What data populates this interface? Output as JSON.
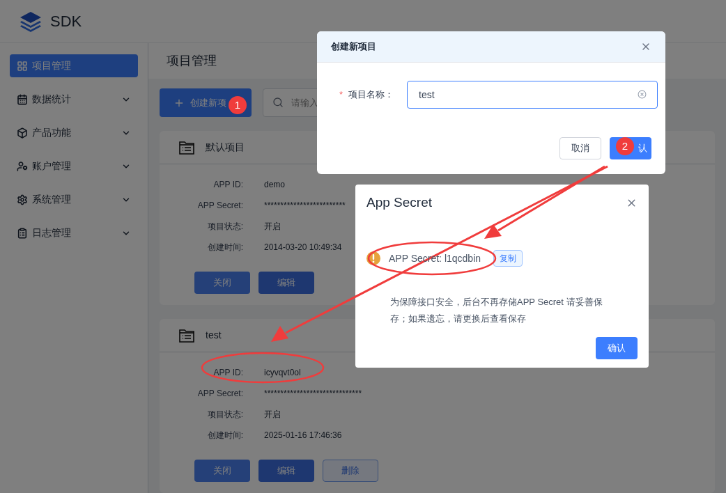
{
  "app": {
    "logo_text": "SDK"
  },
  "sidebar": {
    "items": [
      {
        "label": "项目管理",
        "selected": true,
        "expandable": false
      },
      {
        "label": "数据统计",
        "selected": false,
        "expandable": true
      },
      {
        "label": "产品功能",
        "selected": false,
        "expandable": true
      },
      {
        "label": "账户管理",
        "selected": false,
        "expandable": true
      },
      {
        "label": "系统管理",
        "selected": false,
        "expandable": true
      },
      {
        "label": "日志管理",
        "selected": false,
        "expandable": true
      }
    ]
  },
  "page_title": "项目管理",
  "toolbar": {
    "create_button": "创建新项",
    "search": {
      "placeholder": "请输入"
    }
  },
  "projects": [
    {
      "name": "默认项目",
      "fields": [
        {
          "label": "APP ID:",
          "value": "demo"
        },
        {
          "label": "APP Secret:",
          "value": "*************************"
        },
        {
          "label": "项目状态:",
          "value": "开启"
        },
        {
          "label": "创建时间:",
          "value": "2014-03-20 10:49:34"
        }
      ],
      "buttons": [
        {
          "label": "关闭",
          "kind": "primary"
        },
        {
          "label": "编辑",
          "kind": "dark"
        }
      ]
    },
    {
      "name": "test",
      "fields": [
        {
          "label": "APP ID:",
          "value": "icyvqvt0ol"
        },
        {
          "label": "APP Secret:",
          "value": "******************************"
        },
        {
          "label": "项目状态:",
          "value": "开启"
        },
        {
          "label": "创建时间:",
          "value": "2025-01-16 17:46:36"
        }
      ],
      "buttons": [
        {
          "label": "关闭",
          "kind": "primary"
        },
        {
          "label": "编辑",
          "kind": "dark"
        },
        {
          "label": "删除",
          "kind": "outline"
        }
      ]
    }
  ],
  "create_dialog": {
    "title": "创建新项目",
    "field": {
      "label": "项目名称：",
      "required_mark": "*",
      "value": "test"
    },
    "buttons": [
      {
        "label": "取消",
        "kind": "default"
      },
      {
        "label": "认",
        "kind": "primary"
      }
    ]
  },
  "secret_dialog": {
    "title": "App Secret",
    "secret": "APP Secret: l1qcdbin",
    "copy_button": "复制",
    "note": "为保障接口安全，后台不再存储APP Secret 请妥善保存；如果遗忘，请更换后查看保存",
    "confirm_button": "确认"
  },
  "annotations": [
    {
      "label": "1"
    },
    {
      "label": "2"
    }
  ]
}
